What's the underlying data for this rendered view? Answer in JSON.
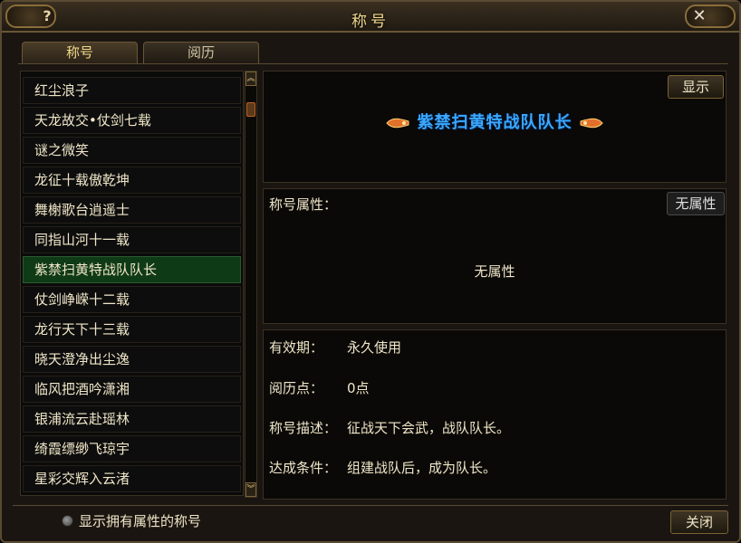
{
  "window": {
    "title": "称号",
    "help_label": "?",
    "close_label": "✕"
  },
  "tabs": [
    {
      "label": "称号",
      "active": true
    },
    {
      "label": "阅历",
      "active": false
    }
  ],
  "title_list": {
    "items": [
      "红尘浪子",
      "天龙故交•仗剑七载",
      "谜之微笑",
      "龙征十载傲乾坤",
      "舞榭歌台逍遥士",
      "同指山河十一载",
      "紫禁扫黄特战队队长",
      "仗剑峥嵘十二载",
      "龙行天下十三载",
      "晓天澄净出尘逸",
      "临风把酒吟潇湘",
      "银浦流云赴瑶林",
      "绮霞缥缈飞琼宇",
      "星彩交辉入云渚"
    ],
    "selected_index": 6
  },
  "scrollbar": {
    "up_label": "︽",
    "down_label": "︾"
  },
  "display_panel": {
    "show_button": "显示",
    "current_title": "紫禁扫黄特战队队长"
  },
  "attributes_panel": {
    "label": "称号属性：",
    "badge": "无属性",
    "center_text": "无属性"
  },
  "details_panel": {
    "validity_label": "有效期：",
    "validity_value": "永久使用",
    "points_label": "阅历点：",
    "points_value": "0点",
    "description_label": "称号描述：",
    "description_value": "征战天下会武，战队队长。",
    "condition_label": "达成条件：",
    "condition_value": "组建战队后，成为队长。"
  },
  "footer": {
    "filter_label": "显示拥有属性的称号",
    "close_button": "关闭"
  },
  "colors": {
    "accent_gold": "#f2d98a",
    "selected_row": "#0f3a16",
    "title_blue": "#3aa8ff"
  }
}
